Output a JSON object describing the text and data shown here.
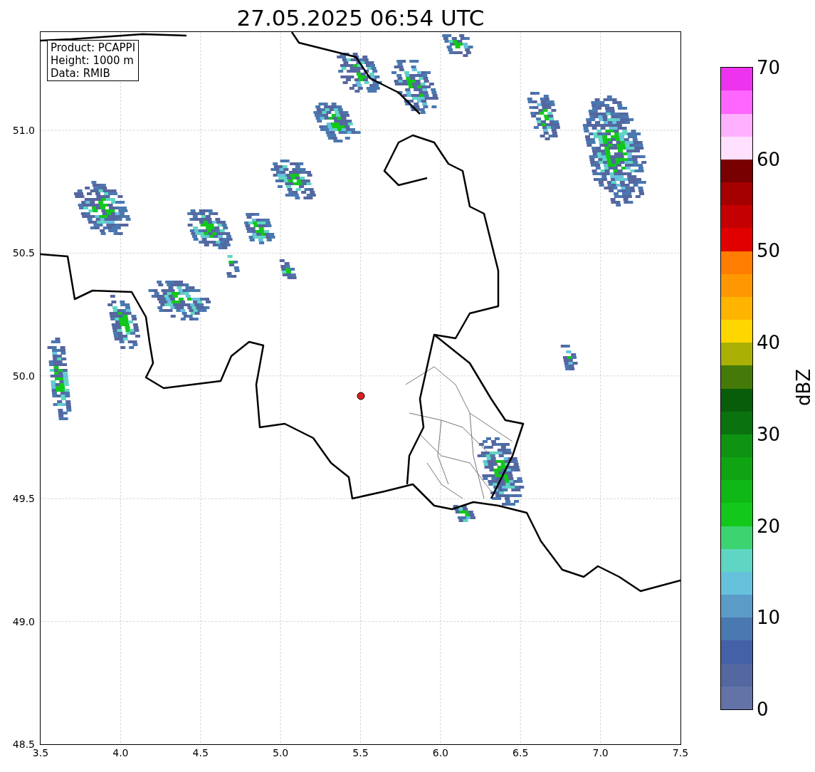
{
  "title": "27.05.2025 06:54 UTC",
  "info_box": [
    "Product: PCAPPI",
    "Height: 1000 m",
    "Data: RMIB"
  ],
  "x_axis": {
    "ticks": [
      "3.5",
      "4.0",
      "4.5",
      "5.0",
      "5.5",
      "6.0",
      "6.5",
      "7.0",
      "7.5"
    ]
  },
  "y_axis": {
    "ticks": [
      "51.0",
      "50.5",
      "50.0",
      "49.5",
      "49.0",
      "48.5"
    ]
  },
  "colorbar": {
    "label": "dBZ",
    "ticks": [
      "70",
      "60",
      "50",
      "40",
      "30",
      "20",
      "10",
      "0"
    ],
    "segments": [
      {
        "color": "#6373a8"
      },
      {
        "color": "#5567a0"
      },
      {
        "color": "#4460a6"
      },
      {
        "color": "#4a78b0"
      },
      {
        "color": "#5b9bc8"
      },
      {
        "color": "#66c1dd"
      },
      {
        "color": "#5fd6c4"
      },
      {
        "color": "#3cd470"
      },
      {
        "color": "#12c81a"
      },
      {
        "color": "#10b815"
      },
      {
        "color": "#0fa412"
      },
      {
        "color": "#0e9312"
      },
      {
        "color": "#0a720e"
      },
      {
        "color": "#085d0a"
      },
      {
        "color": "#467a08"
      },
      {
        "color": "#aab004"
      },
      {
        "color": "#ffd700"
      },
      {
        "color": "#ffb400"
      },
      {
        "color": "#ff9800"
      },
      {
        "color": "#ff7d00"
      },
      {
        "color": "#e00000"
      },
      {
        "color": "#c40000"
      },
      {
        "color": "#a40000"
      },
      {
        "color": "#780000"
      },
      {
        "color": "#ffe0ff"
      },
      {
        "color": "#ffb0ff"
      },
      {
        "color": "#ff66ff"
      },
      {
        "color": "#ee33ee"
      }
    ]
  }
}
